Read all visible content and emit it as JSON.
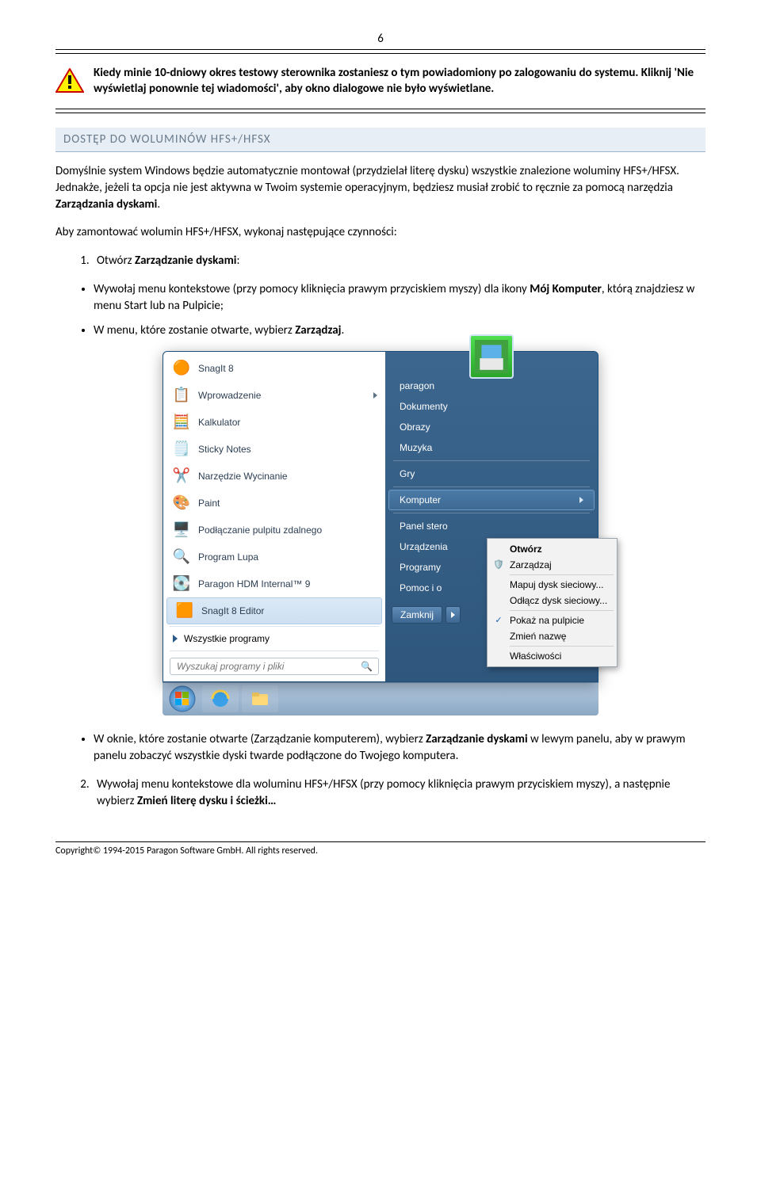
{
  "page_number": "6",
  "callout": "Kiedy minie 10-dniowy okres testowy sterownika zostaniesz o tym powiadomiony po zalogowaniu do systemu. Kliknij 'Nie wyświetlaj ponownie tej wiadomości', aby okno dialogowe nie było wyświetlane.",
  "section_title": "DOSTĘP DO WOLUMINÓW HFS+/HFSX",
  "para1a": "Domyślnie system Windows będzie automatycznie montował (przydzielał literę dysku) wszystkie znalezione woluminy HFS+/HFSX. Jednakże, jeżeli ta opcja nie jest aktywna w Twoim systemie operacyjnym, będziesz musiał zrobić to ręcznie za pomocą narzędzia ",
  "para1b": "Zarządzania dyskami",
  "para1c": ".",
  "para2": "Aby zamontować wolumin HFS+/HFSX, wykonaj następujące czynności:",
  "step1a": "Otwórz ",
  "step1b": "Zarządzanie dyskami",
  "step1c": ":",
  "bullet1a": "Wywołaj menu kontekstowe (przy pomocy kliknięcia prawym przyciskiem myszy) dla ikony ",
  "bullet1b": "Mój Komputer",
  "bullet1c": ", którą znajdziesz w menu Start lub na Pulpicie;",
  "bullet2a": "W menu, które zostanie otwarte, wybierz ",
  "bullet2b": "Zarządzaj",
  "bullet2c": ".",
  "bullet3a": "W oknie, które zostanie otwarte (Zarządzanie komputerem), wybierz ",
  "bullet3b": "Zarządzanie dyskami",
  "bullet3c": " w lewym panelu, aby w prawym panelu zobaczyć wszystkie dyski twarde podłączone do Twojego komputera.",
  "step2a": "Wywołaj menu kontekstowe dla woluminu HFS+/HFSX (przy pomocy kliknięcia prawym przyciskiem myszy), a następnie wybierz ",
  "step2b": "Zmień literę dysku i ścieżki…",
  "startmenu": {
    "left_items": [
      "SnagIt 8",
      "Wprowadzenie",
      "Kalkulator",
      "Sticky Notes",
      "Narzędzie Wycinanie",
      "Paint",
      "Podłączanie pulpitu zdalnego",
      "Program Lupa",
      "Paragon HDM Internal™ 9",
      "SnagIt 8 Editor"
    ],
    "all_programs": "Wszystkie programy",
    "search_placeholder": "Wyszukaj programy i pliki",
    "right_items": [
      "paragon",
      "Dokumenty",
      "Obrazy",
      "Muzyka",
      "Gry",
      "Komputer",
      "Panel stero",
      "Urządzenia",
      "Programy",
      "Pomoc i o"
    ],
    "shutdown": "Zamknij"
  },
  "contextmenu": {
    "items": [
      "Otwórz",
      "Zarządzaj",
      "Mapuj dysk sieciowy...",
      "Odłącz dysk sieciowy...",
      "Pokaż na pulpicie",
      "Zmień nazwę",
      "Właściwości"
    ]
  },
  "footer": "Copyright© 1994-2015 Paragon Software GmbH. All rights reserved."
}
